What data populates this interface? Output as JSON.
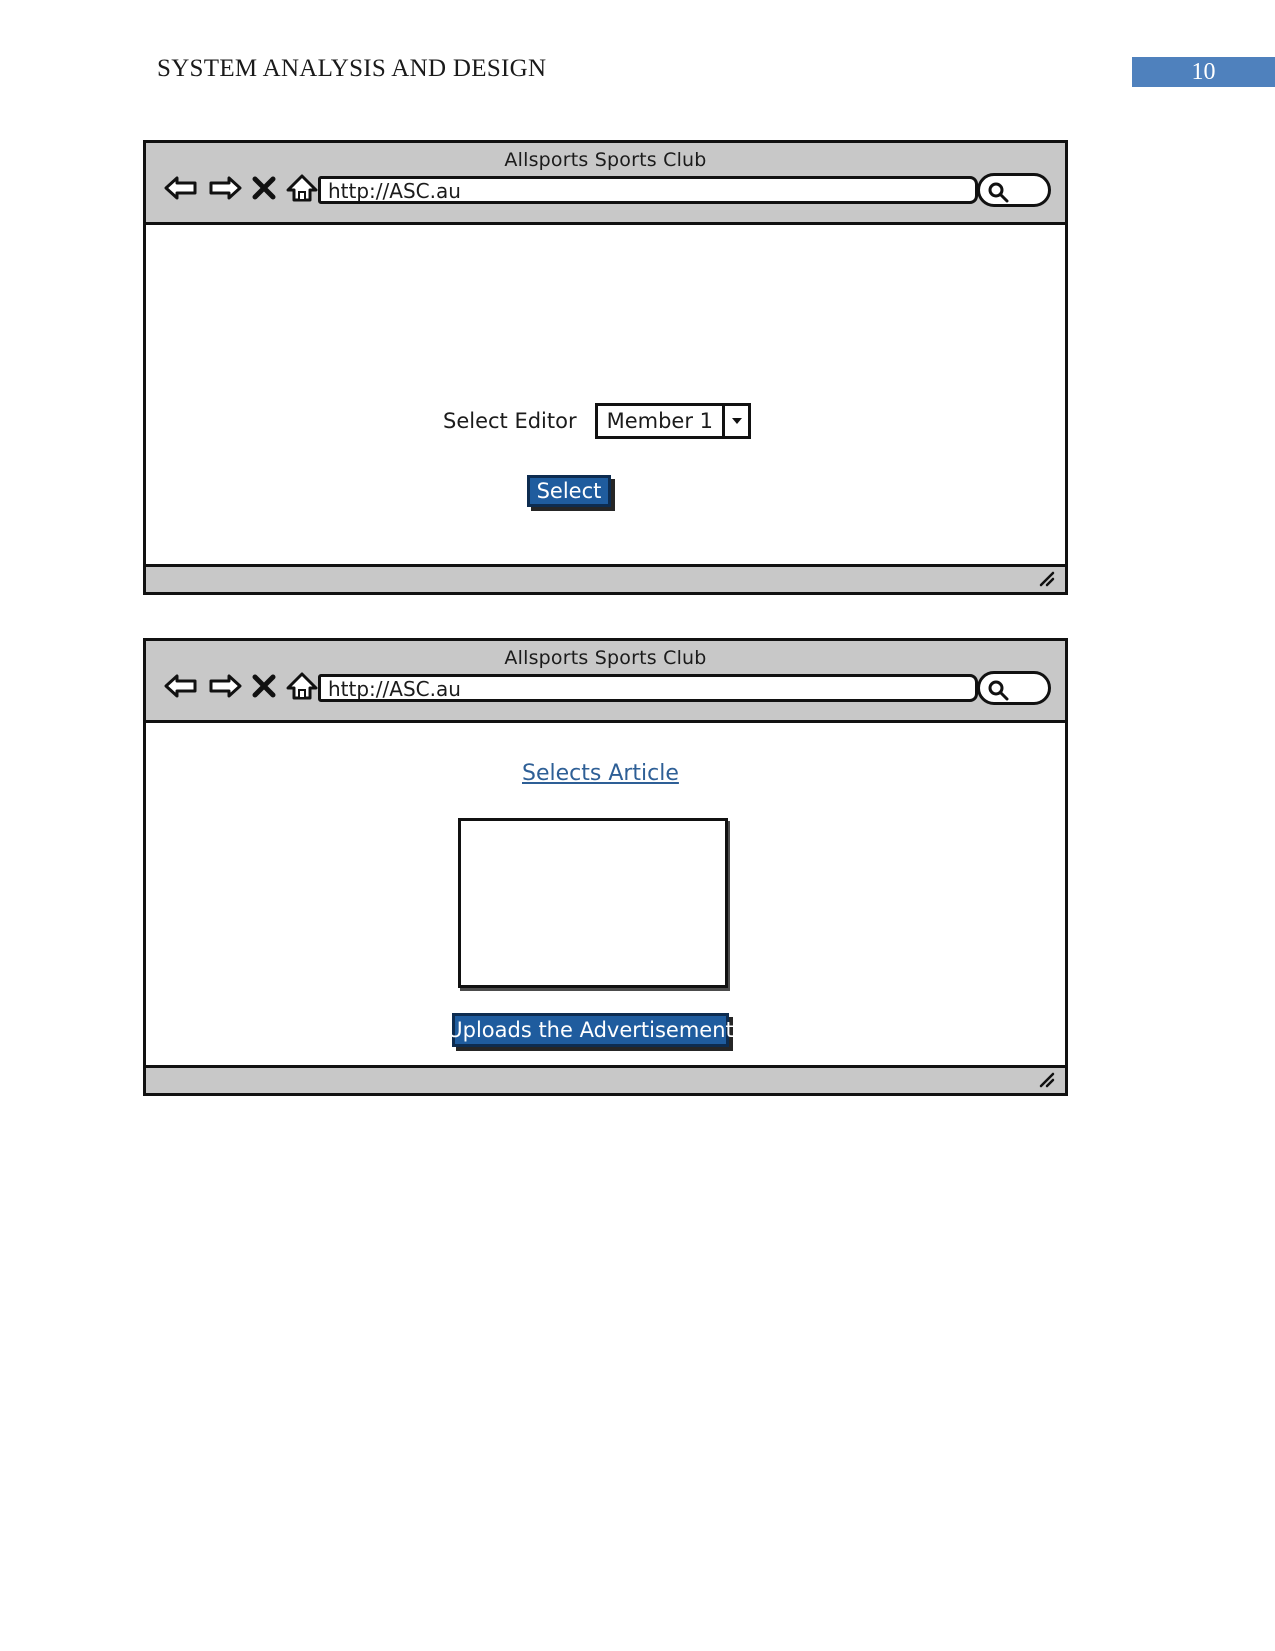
{
  "document": {
    "header_title": "SYSTEM ANALYSIS AND DESIGN",
    "page_number": "10",
    "accent_color": "#4f81bd"
  },
  "windows": [
    {
      "id": "select-editor-window",
      "title": "Allsports Sports Club",
      "url": "http://ASC.au",
      "nav": {
        "back": "back-arrow",
        "forward": "forward-arrow",
        "stop": "close-x",
        "home": "home"
      },
      "search_icon": "search-icon",
      "resize_grip": "resize-grip",
      "content": {
        "field_label": "Select Editor",
        "dropdown_value": "Member 1",
        "dropdown_arrow": "chevron-down-icon",
        "submit_label": "Select"
      }
    },
    {
      "id": "upload-advertisement-window",
      "title": "Allsports Sports Club",
      "url": "http://ASC.au",
      "nav": {
        "back": "back-arrow",
        "forward": "forward-arrow",
        "stop": "close-x",
        "home": "home"
      },
      "search_icon": "search-icon",
      "resize_grip": "resize-grip",
      "content": {
        "link_label": "Selects Article",
        "image_placeholder": "image-placeholder",
        "submit_label": "Uploads the Advertisement"
      }
    }
  ],
  "colors": {
    "button_fill": "#1f5c9e",
    "button_border": "#0d2c50",
    "chrome_gray": "#c8c8c8",
    "link_blue": "#2e5f96"
  }
}
